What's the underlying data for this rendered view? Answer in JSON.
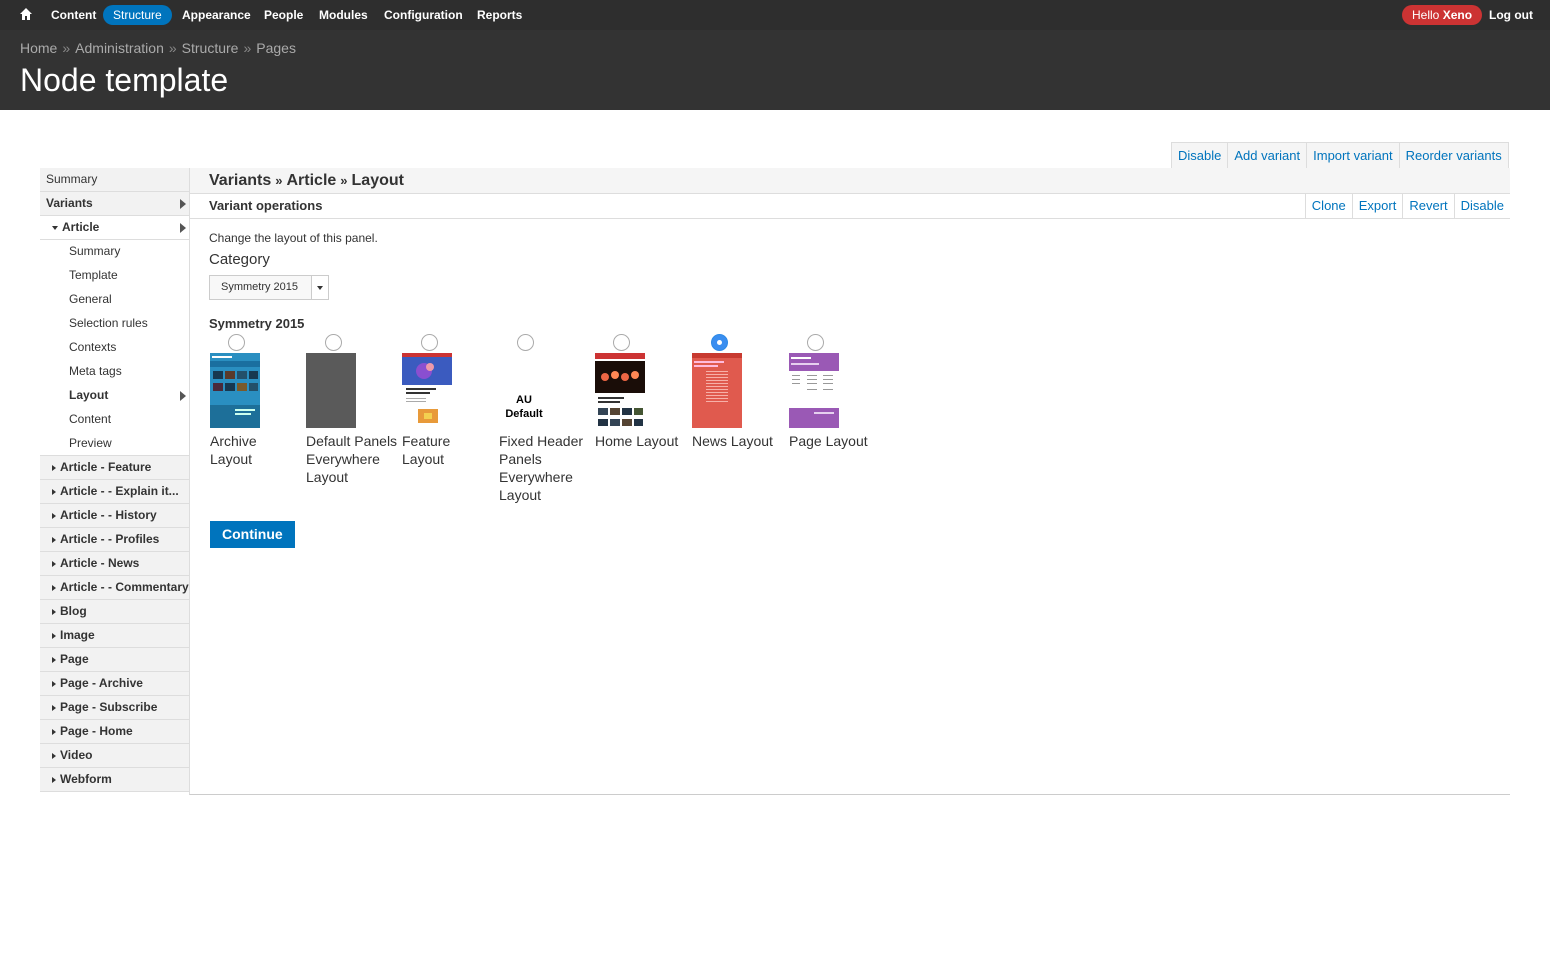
{
  "toolbar": {
    "items": [
      "Content",
      "Structure",
      "Appearance",
      "People",
      "Modules",
      "Configuration",
      "Reports"
    ],
    "hello": "Hello",
    "user": "Xeno",
    "logout": "Log out",
    "active_color": "#0074bd"
  },
  "header": {
    "breadcrumb": [
      "Home",
      "Administration",
      "Structure",
      "Pages"
    ],
    "separator": "»",
    "title": "Node template"
  },
  "page_actions": [
    "Disable",
    "Add variant",
    "Import variant",
    "Reorder variants"
  ],
  "sidebar": {
    "summary": "Summary",
    "variants": "Variants",
    "article": "Article",
    "article_children": [
      "Summary",
      "Template",
      "General",
      "Selection rules",
      "Contexts",
      "Meta tags",
      "Layout",
      "Content",
      "Preview"
    ],
    "active_child": "Layout",
    "others": [
      "Article - Feature",
      "Article - - Explain it...",
      "Article - - History",
      "Article - - Profiles",
      "Article - News",
      "Article - - Commentary",
      "Blog",
      "Image",
      "Page",
      "Page - Archive",
      "Page - Subscribe",
      "Page - Home",
      "Video",
      "Webform"
    ]
  },
  "main": {
    "crumbs": [
      "Variants",
      "Article",
      "Layout"
    ],
    "variant_ops": "Variant operations",
    "variant_actions": [
      "Clone",
      "Export",
      "Revert",
      "Disable"
    ],
    "description": "Change the layout of this panel.",
    "category_label": "Category",
    "category_value": "Symmetry 2015",
    "group_label": "Symmetry 2015",
    "layouts": [
      {
        "label": "Archive Layout",
        "selected": false
      },
      {
        "label": "Default Panels Everywhere Layout",
        "selected": false
      },
      {
        "label": "Feature Layout",
        "selected": false
      },
      {
        "label": "Fixed Header Panels Everywhere Layout",
        "selected": false,
        "thumb_text": "AU Default"
      },
      {
        "label": "Home Layout",
        "selected": false
      },
      {
        "label": "News Layout",
        "selected": true
      },
      {
        "label": "Page Layout",
        "selected": false
      }
    ],
    "continue": "Continue"
  }
}
